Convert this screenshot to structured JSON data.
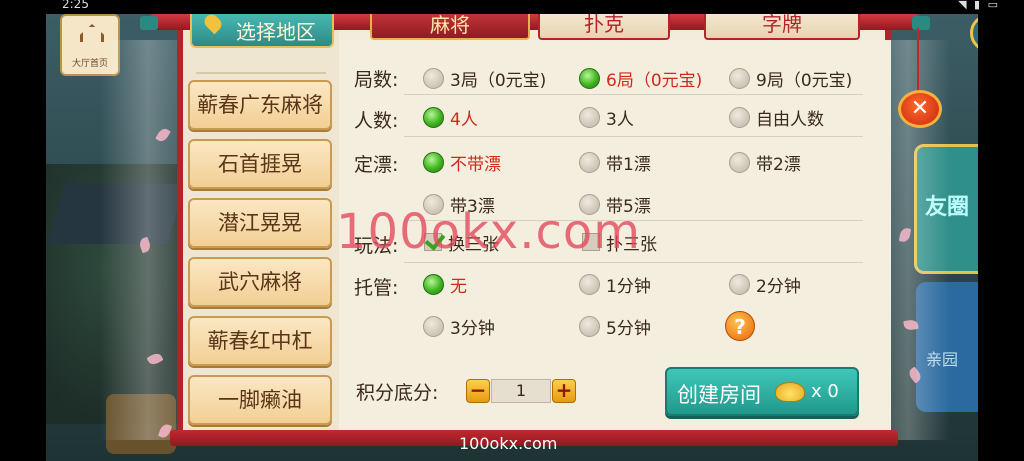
{
  "status_bar": {
    "time": "2:25",
    "icons": "◥ ▮ ▭"
  },
  "background": {
    "house_label": "大厅首页",
    "side_panel_a": "友圈",
    "side_panel_b": "亲园"
  },
  "region_tab": {
    "label": "选择地区"
  },
  "game_tabs": [
    {
      "label": "麻将",
      "active": true
    },
    {
      "label": "扑克",
      "active": false
    },
    {
      "label": "字牌",
      "active": false
    }
  ],
  "regions": [
    "蕲春广东麻将",
    "石首捱晃",
    "潜江晃晃",
    "武穴麻将",
    "蕲春红中杠",
    "一脚癞油"
  ],
  "rules": {
    "rounds": {
      "label": "局数:",
      "options": [
        "3局（0元宝)",
        "6局（0元宝)",
        "9局（0元宝)"
      ],
      "selected": 1
    },
    "players": {
      "label": "人数:",
      "options": [
        "4人",
        "3人",
        "自由人数"
      ],
      "selected": 0
    },
    "piao": {
      "label": "定漂:",
      "options": [
        "不带漂",
        "带1漂",
        "带2漂",
        "带3漂",
        "带5漂"
      ],
      "selected": 0
    },
    "play": {
      "label": "玩法:",
      "options": [
        "换三张",
        "扑三张"
      ],
      "checked": [
        true,
        false
      ]
    },
    "hosting": {
      "label": "托管:",
      "options": [
        "无",
        "1分钟",
        "2分钟",
        "3分钟",
        "5分钟"
      ],
      "selected": 0
    }
  },
  "score": {
    "label": "积分底分:",
    "minus": "−",
    "plus": "+",
    "value": "1"
  },
  "create_button": {
    "label": "创建房间",
    "count": "x 0"
  },
  "close_button": {
    "glyph": "✕"
  },
  "help_button": {
    "glyph": "?"
  },
  "watermark": {
    "big": "100okx.com",
    "small": "100okx.com"
  },
  "colors": {
    "selected_text": "#d02a1e",
    "accent_red": "#b3242a",
    "create_teal": "#21998c"
  }
}
